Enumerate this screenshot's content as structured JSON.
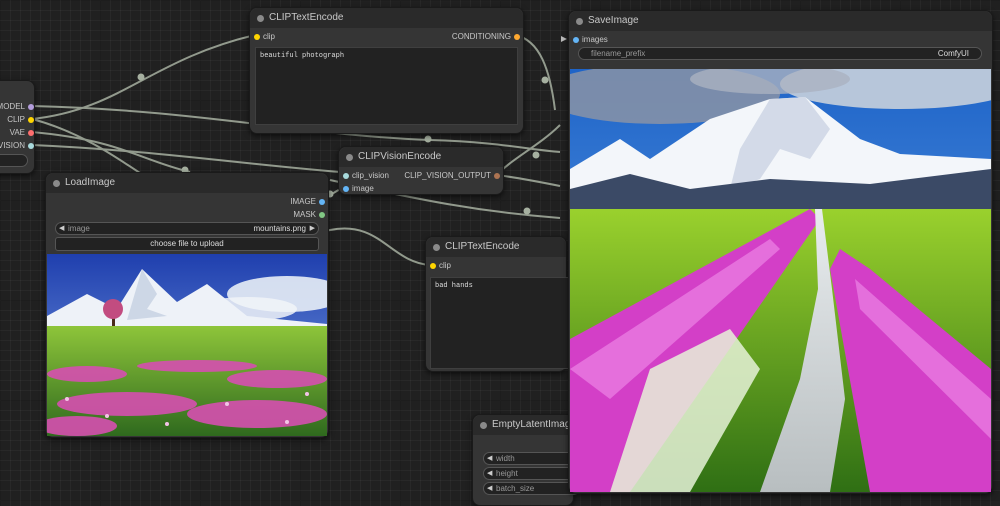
{
  "colors": {
    "canvas_bg": "#202020",
    "node_bg": "#353535",
    "title_bg": "#2a2a2a",
    "wire": "#a6b0a0",
    "clip_slot": "#ffd500",
    "conditioning_slot": "#ffa931",
    "model_slot": "#b39ddb",
    "vae_slot": "#ff6e6e",
    "image_slot": "#64b5f6",
    "mask_slot": "#81c784",
    "clip_vision_slot": "#a8dadc",
    "clip_vision_output_slot": "#ad7452"
  },
  "checkpoint_node": {
    "outputs": [
      "MODEL",
      "CLIP",
      "VAE",
      "CLIP_VISION"
    ]
  },
  "clip_text_encode_top": {
    "title": "CLIPTextEncode",
    "input_clip": "clip",
    "output": "CONDITIONING",
    "text": "beautiful photograph"
  },
  "clip_vision_encode": {
    "title": "CLIPVisionEncode",
    "input_clip_vision": "clip_vision",
    "input_image": "image",
    "output": "CLIP_VISION_OUTPUT"
  },
  "load_image": {
    "title": "LoadImage",
    "output_image": "IMAGE",
    "output_mask": "MASK",
    "image_label": "image",
    "image_value": "mountains.png",
    "upload_button": "choose file to upload",
    "preview_icon": "mountain-meadow-photo"
  },
  "clip_text_encode_bottom": {
    "title": "CLIPTextEncode",
    "input_clip": "clip",
    "text": "bad hands"
  },
  "empty_latent": {
    "title": "EmptyLatentImag",
    "widgets": [
      "width",
      "height",
      "batch_size"
    ]
  },
  "save_image": {
    "title": "SaveImage",
    "input_images": "images",
    "prefix_label": "filename_prefix",
    "prefix_value": "ComfyUI",
    "preview_icon": "generated-mountain-path-photo"
  }
}
